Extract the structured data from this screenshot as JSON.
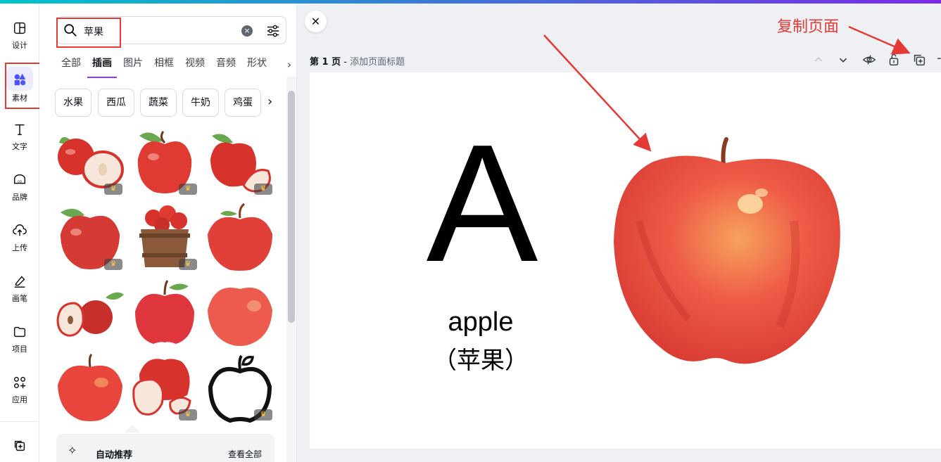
{
  "sidebar": {
    "items": [
      {
        "label": "设计",
        "icon": "layout-icon"
      },
      {
        "label": "素材",
        "icon": "elements-icon"
      },
      {
        "label": "文字",
        "icon": "text-icon"
      },
      {
        "label": "品牌",
        "icon": "brand-icon"
      },
      {
        "label": "上传",
        "icon": "upload-icon"
      },
      {
        "label": "画笔",
        "icon": "pen-icon"
      },
      {
        "label": "项目",
        "icon": "folder-icon"
      },
      {
        "label": "应用",
        "icon": "apps-icon"
      },
      {
        "label": "",
        "icon": "magic-icon"
      }
    ]
  },
  "search": {
    "value": "苹果",
    "clear": "×"
  },
  "tabs": [
    "全部",
    "插画",
    "图片",
    "相框",
    "视频",
    "音频",
    "形状"
  ],
  "chips": [
    "水果",
    "西瓜",
    "蔬菜",
    "牛奶",
    "鸡蛋"
  ],
  "recommend": {
    "title": "自动推荐",
    "link": "查看全部"
  },
  "canvas": {
    "page_number": "第 1 页",
    "separator": " - ",
    "add_title": "添加页面标题",
    "letter": "A",
    "word": "apple",
    "cn_word": "（苹果）"
  },
  "annotation": {
    "text": "复制页面",
    "color": "#e53935"
  },
  "colors": {
    "accent": "#8b3dff",
    "apple_red": "#e8453c"
  }
}
